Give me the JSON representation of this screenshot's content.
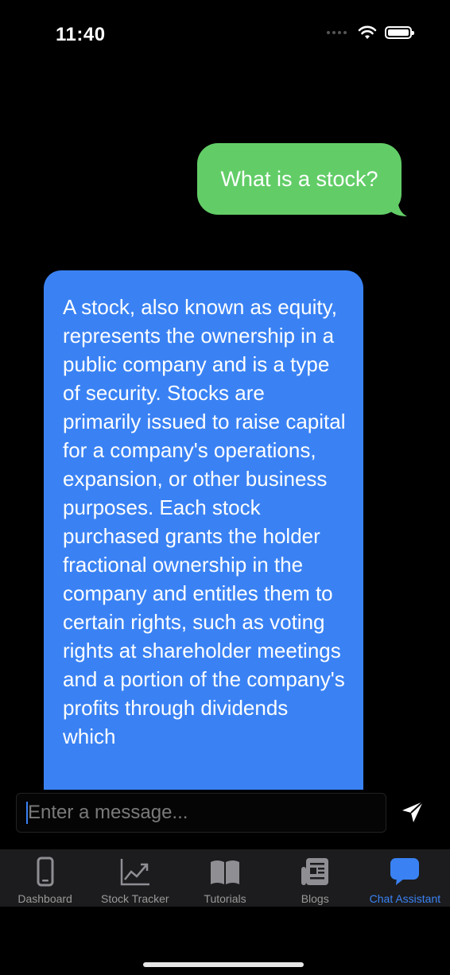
{
  "status_bar": {
    "time": "11:40"
  },
  "chat": {
    "messages": [
      {
        "role": "user",
        "text": "What is a stock?",
        "color": "#62cd67"
      },
      {
        "role": "assistant",
        "color": "#3a82f4",
        "text": "A stock, also known as equity, represents the ownership in a public company and is a type of security. Stocks are primarily issued to raise capital for a company's operations, expansion, or other business purposes. Each stock purchased grants the holder fractional ownership in the company and entitles them to certain rights, such as voting rights at shareholder meetings and a portion of the company's profits through dividends which"
      }
    ]
  },
  "composer": {
    "placeholder": "Enter a message...",
    "send_icon": "paper-plane-icon"
  },
  "tabs": [
    {
      "label": "Dashboard",
      "icon": "phone-icon",
      "active": false
    },
    {
      "label": "Stock Tracker",
      "icon": "chart-up-icon",
      "active": false
    },
    {
      "label": "Tutorials",
      "icon": "book-icon",
      "active": false
    },
    {
      "label": "Blogs",
      "icon": "newspaper-icon",
      "active": false
    },
    {
      "label": "Chat Assistant",
      "icon": "chat-bubble-icon",
      "active": true
    }
  ],
  "colors": {
    "accent": "#3a82f4",
    "user_bubble": "#62cd67",
    "tabbar_bg": "#1c1c1e"
  }
}
